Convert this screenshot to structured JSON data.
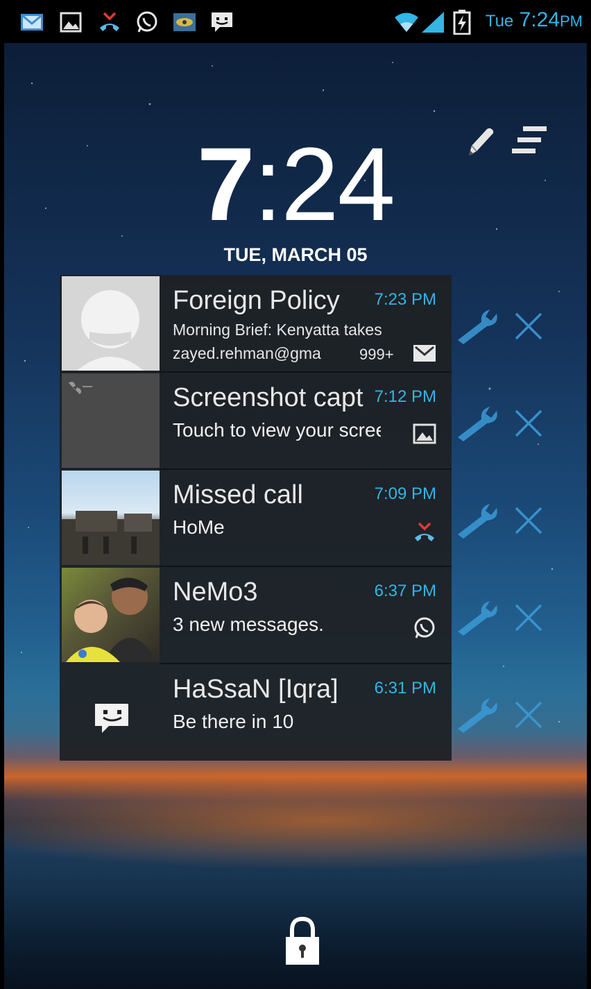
{
  "status_bar": {
    "day": "Tue",
    "time": "7:24",
    "ampm": "PM",
    "left_icons": [
      "gmail-icon",
      "gallery-icon",
      "missed-call-icon",
      "whatsapp-icon",
      "image-thumb-icon",
      "message-icon"
    ],
    "right_icons": [
      "wifi-icon",
      "signal-icon",
      "battery-charging-icon"
    ],
    "accent": "#33b5e5"
  },
  "lockscreen": {
    "clock_hours": "7",
    "clock_sep": ":",
    "clock_minutes": "24",
    "date": "TUE, MARCH 05"
  },
  "notifications": [
    {
      "title": "Foreign Policy",
      "time": "7:23 PM",
      "text": "Morning Brief:  Kenyatta takes",
      "sub": "zayed.rehman@gma",
      "count": "999+",
      "icon": "gmail-icon"
    },
    {
      "title": "Screenshot captured",
      "time": "7:12 PM",
      "text": "Touch to view your screenshot",
      "icon": "gallery-icon"
    },
    {
      "title": "Missed call",
      "time": "7:09 PM",
      "text": "HoMe",
      "icon": "missed-call-icon"
    },
    {
      "title": "NeMo3",
      "time": "6:37 PM",
      "text": "3 new messages.",
      "icon": "whatsapp-icon"
    },
    {
      "title": "HaSsaN [Iqra]",
      "time": "6:31 PM",
      "text": "Be there in 10",
      "icon": "message-icon"
    }
  ]
}
